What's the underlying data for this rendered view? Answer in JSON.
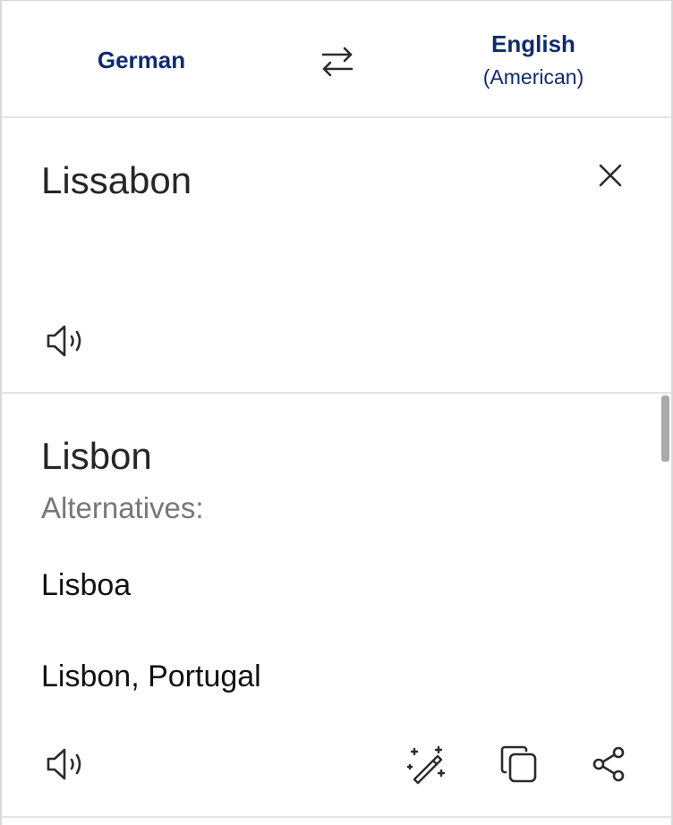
{
  "languages": {
    "source": {
      "name": "German"
    },
    "target": {
      "name": "English",
      "variant": "(American)"
    }
  },
  "source": {
    "text": "Lissabon"
  },
  "result": {
    "translation": "Lisbon",
    "alternatives_label": "Alternatives:",
    "alternatives": [
      "Lisboa",
      "Lisbon, Portugal"
    ]
  },
  "icons": {
    "swap": "swap-arrows-icon",
    "clear": "close-icon",
    "speak": "speaker-icon",
    "improve": "magic-wand-icon",
    "copy": "copy-icon",
    "share": "share-icon"
  },
  "colors": {
    "accent": "#0f2b6e",
    "text": "#262626",
    "muted": "#777777",
    "divider": "#e4e4e4"
  }
}
